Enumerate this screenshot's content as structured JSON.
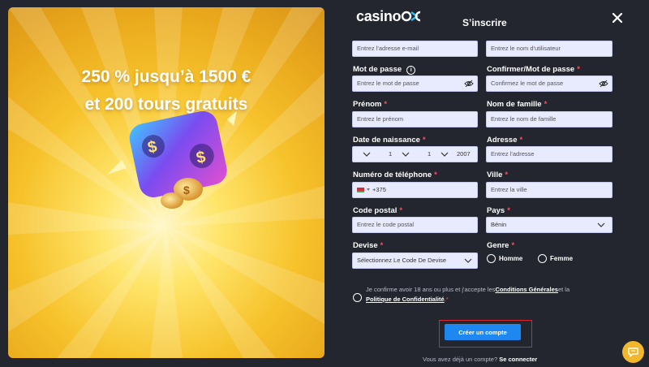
{
  "promo": {
    "line1": "250 % jusqu’à 1500 €",
    "line2": "et 200 tours gratuits"
  },
  "header": {
    "logo_text": "casino",
    "title": "S’inscrire",
    "close_icon": "close-icon"
  },
  "form": {
    "email": {
      "placeholder": "Entrez l'adresse e-mail"
    },
    "username": {
      "placeholder": "Entrez le nom d'utilisateur"
    },
    "password": {
      "label": "Mot de passe",
      "required": "*",
      "info": "i",
      "placeholder": "Entrez le mot de passe"
    },
    "confirm_password": {
      "label": "Confirmer/Mot de passe",
      "required": "*",
      "placeholder": "Confirmez le mot de passe"
    },
    "first_name": {
      "label": "Prénom",
      "required": "*",
      "placeholder": "Entrez le prénom"
    },
    "last_name": {
      "label": "Nom de famille",
      "required": "*",
      "placeholder": "Entrez le nom de famille"
    },
    "birth_date": {
      "label": "Date de naissance",
      "required": "*",
      "day": "1",
      "month": "1",
      "year": "2007"
    },
    "address": {
      "label": "Adresse",
      "required": "*",
      "placeholder": "Entrez l'adresse"
    },
    "phone": {
      "label": "Numéro de téléphone",
      "required": "*",
      "prefix": "+375"
    },
    "city": {
      "label": "Ville",
      "required": "*",
      "placeholder": "Entrez la ville"
    },
    "postal_code": {
      "label": "Code postal",
      "required": "*",
      "placeholder": "Entrez le code postal"
    },
    "country": {
      "label": "Pays",
      "required": "*",
      "value": "Bénin"
    },
    "currency": {
      "label": "Devise",
      "required": "*",
      "placeholder": "Sélectionnez Le Code De Devise"
    },
    "gender": {
      "label": "Genre",
      "required": "*",
      "options": [
        "Homme",
        "Femme"
      ]
    }
  },
  "terms": {
    "text_before": "Je confirme avoir 18 ans ou plus et j'accepte les",
    "link1": "Conditions Générales",
    "text_middle": "et la",
    "link2": "Politique de Confidentialité",
    "text_after": ".",
    "required": "*"
  },
  "submit_label": "Créer un compte",
  "login": {
    "prompt": "Vous avez déjà un compte?",
    "link": "Se connecter"
  },
  "colors": {
    "accent": "#1e88f0",
    "required": "#ff4d5e",
    "panel": "#23262f",
    "highlight_frame": "#d9252d"
  },
  "icons": [
    "close-icon",
    "eye-off-icon",
    "chevron-down-icon",
    "info-icon",
    "chat-icon",
    "flag-icon"
  ]
}
